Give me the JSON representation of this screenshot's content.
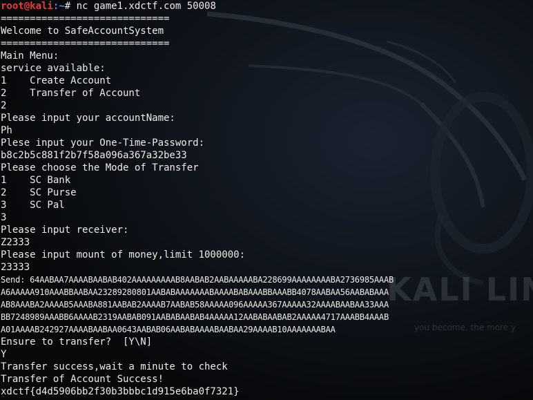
{
  "prompt": {
    "user_host": "root@kali",
    "path": ":~",
    "symbol": "# ",
    "command": "nc game1.xdctf.com 50008"
  },
  "lines": [
    "=============================",
    "Welcome to SafeAccountSystem",
    "=============================",
    "Main Menu:",
    "service available:",
    "1    Create Account",
    "2    Transfer of Account",
    "2",
    "Please input your accountName:",
    "Ph",
    "Plese input your One-Time-Password:",
    "b8c2b5c881f2b7f58a096a367a32be33",
    "Please choose the Mode of Transfer",
    "1    SC Bank",
    "2    SC Purse",
    "3    SC Pal",
    "3",
    "Please input receiver:",
    "Z2333",
    "Please input mount of money,limit 1000000:",
    "23333",
    "Send: 64AABAA7AAAABAABAB402AAAAAAAAAB8AABAB2AABAAAAABA228699AAAAAAAABA2736985AAAB",
    "A6AAAAA910AAABBAABAA23289280801AABABAAAAAAABAAAABABAAABBAAABB4078AABAA56AABABAAA",
    "AB8AAABA2AAAAB5AAABA881AABAB2AAAAB7AABAB58AAAAA096AAAAA367AAAAA32AAAABAABAA33AAA",
    "BB7248989AAABB6AAAAB2319AABAB091AABABAABAB4AAAAA12AABABAABAB2AAAAA4717AAABB4AAAB",
    "A01AAAAB242927AAAABAABAA0643AABAB06AABABAAAABAABAA29AAAAB10AAAAAAABAA",
    "Ensure to transfer?  [Y\\N]",
    "Y",
    "Transfer success,wait a minute to check",
    "Transfer of Account Success!",
    "xdctf{d4d5906bb2f30b3bbbc1d915e6ba0f7321}"
  ],
  "wallpaper": {
    "watermark_text": "KALI LIN",
    "tagline": "you become, the more y",
    "background_color": "#0a0c0f",
    "text_color": "#ececec",
    "prompt_user_color": "#e83a3a",
    "prompt_path_color": "#5b8ee6"
  }
}
